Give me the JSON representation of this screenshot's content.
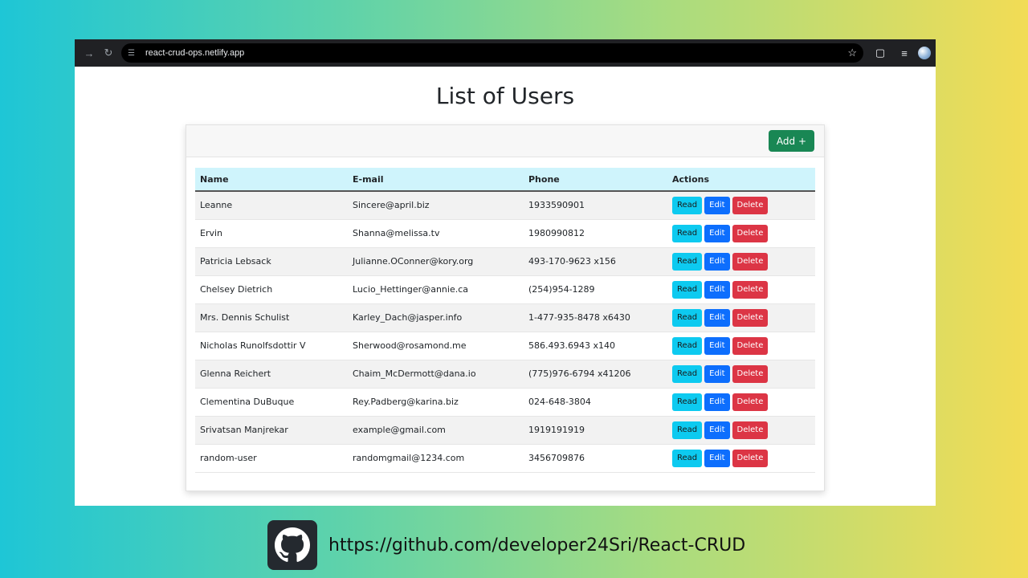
{
  "browser": {
    "url": "react-crud-ops.netlify.app"
  },
  "page": {
    "title": "List of Users",
    "add_label": "Add +"
  },
  "table": {
    "headers": [
      "Name",
      "E-mail",
      "Phone",
      "Actions"
    ],
    "rows": [
      {
        "name": "Leanne",
        "email": "Sincere@april.biz",
        "phone": "1933590901"
      },
      {
        "name": "Ervin",
        "email": "Shanna@melissa.tv",
        "phone": "1980990812"
      },
      {
        "name": "Patricia Lebsack",
        "email": "Julianne.OConner@kory.org",
        "phone": "493-170-9623 x156"
      },
      {
        "name": "Chelsey Dietrich",
        "email": "Lucio_Hettinger@annie.ca",
        "phone": "(254)954-1289"
      },
      {
        "name": "Mrs. Dennis Schulist",
        "email": "Karley_Dach@jasper.info",
        "phone": "1-477-935-8478 x6430"
      },
      {
        "name": "Nicholas Runolfsdottir V",
        "email": "Sherwood@rosamond.me",
        "phone": "586.493.6943 x140"
      },
      {
        "name": "Glenna Reichert",
        "email": "Chaim_McDermott@dana.io",
        "phone": "(775)976-6794 x41206"
      },
      {
        "name": "Clementina DuBuque",
        "email": "Rey.Padberg@karina.biz",
        "phone": "024-648-3804"
      },
      {
        "name": "Srivatsan Manjrekar",
        "email": "example@gmail.com",
        "phone": "1919191919"
      },
      {
        "name": "random-user",
        "email": "randomgmail@1234.com",
        "phone": "3456709876"
      }
    ],
    "actions": {
      "read": "Read",
      "edit": "Edit",
      "delete": "Delete"
    }
  },
  "footer": {
    "link": "https://github.com/developer24Sri/React-CRUD",
    "icon": "github-icon"
  }
}
